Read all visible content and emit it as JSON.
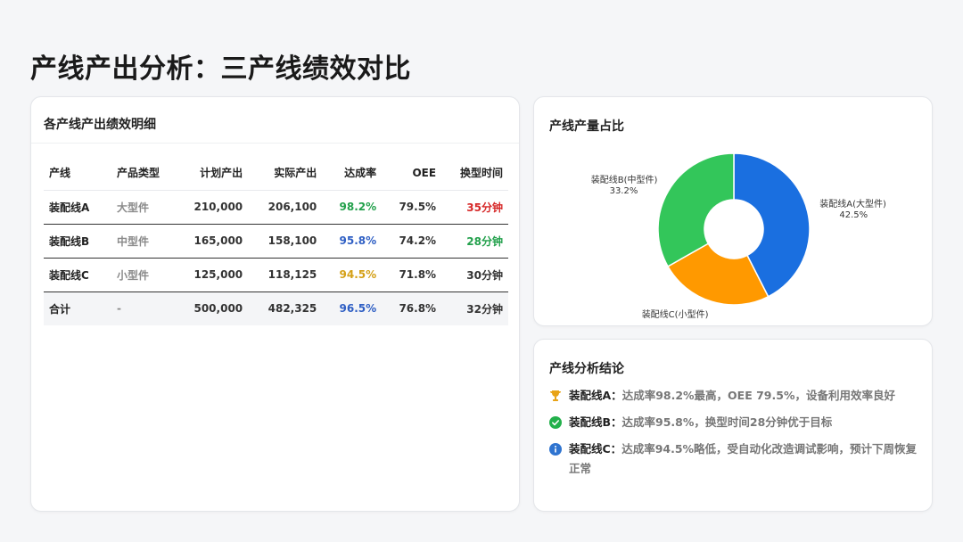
{
  "page": {
    "title": "产线产出分析：三产线绩效对比"
  },
  "table": {
    "title": "各产线产出绩效明细",
    "headers": [
      "产线",
      "产品类型",
      "计划产出",
      "实际产出",
      "达成率",
      "OEE",
      "换型时间"
    ],
    "rows": [
      {
        "line": "装配线A",
        "type": "大型件",
        "plan": "210,000",
        "actual": "206,100",
        "rate": "98.2%",
        "oee": "79.5%",
        "changeover": "35分钟",
        "rate_color": "#22a04b",
        "changeover_color": "#d62828"
      },
      {
        "line": "装配线B",
        "type": "中型件",
        "plan": "165,000",
        "actual": "158,100",
        "rate": "95.8%",
        "oee": "74.2%",
        "changeover": "28分钟",
        "rate_color": "#2f5fc4",
        "changeover_color": "#22a04b"
      },
      {
        "line": "装配线C",
        "type": "小型件",
        "plan": "125,000",
        "actual": "118,125",
        "rate": "94.5%",
        "oee": "71.8%",
        "changeover": "30分钟",
        "rate_color": "#d4a017",
        "changeover_color": "#333333"
      }
    ],
    "total": {
      "line": "合计",
      "type": "-",
      "plan": "500,000",
      "actual": "482,325",
      "rate": "96.5%",
      "oee": "76.8%",
      "changeover": "32分钟",
      "rate_color": "#2f5fc4"
    }
  },
  "chart_data": {
    "type": "pie",
    "title": "产线产量占比",
    "categories": [
      "装配线A(大型件)",
      "装配线C(小型件)",
      "装配线B(中型件)"
    ],
    "values": [
      42.5,
      24.3,
      33.2
    ],
    "labels": [
      "装配线A(大型件)\n42.5%",
      "装配线C(小型件)",
      "装配线B(中型件)\n33.2%"
    ],
    "colors": [
      "#1a6fe0",
      "#ff9900",
      "#33c65a"
    ],
    "donut": true
  },
  "conclusions": {
    "title": "产线分析结论",
    "items": [
      {
        "icon": "trophy-icon",
        "name": "装配线A：",
        "text": "达成率98.2%最高，OEE 79.5%，设备利用效率良好",
        "color": "#e8a317"
      },
      {
        "icon": "check-circle-icon",
        "name": "装配线B：",
        "text": "达成率95.8%，换型时间28分钟优于目标",
        "color": "#22b04b"
      },
      {
        "icon": "info-circle-icon",
        "name": "装配线C：",
        "text": "达成率94.5%略低，受自动化改造调试影响，预计下周恢复正常",
        "color": "#2f74d0"
      }
    ]
  }
}
